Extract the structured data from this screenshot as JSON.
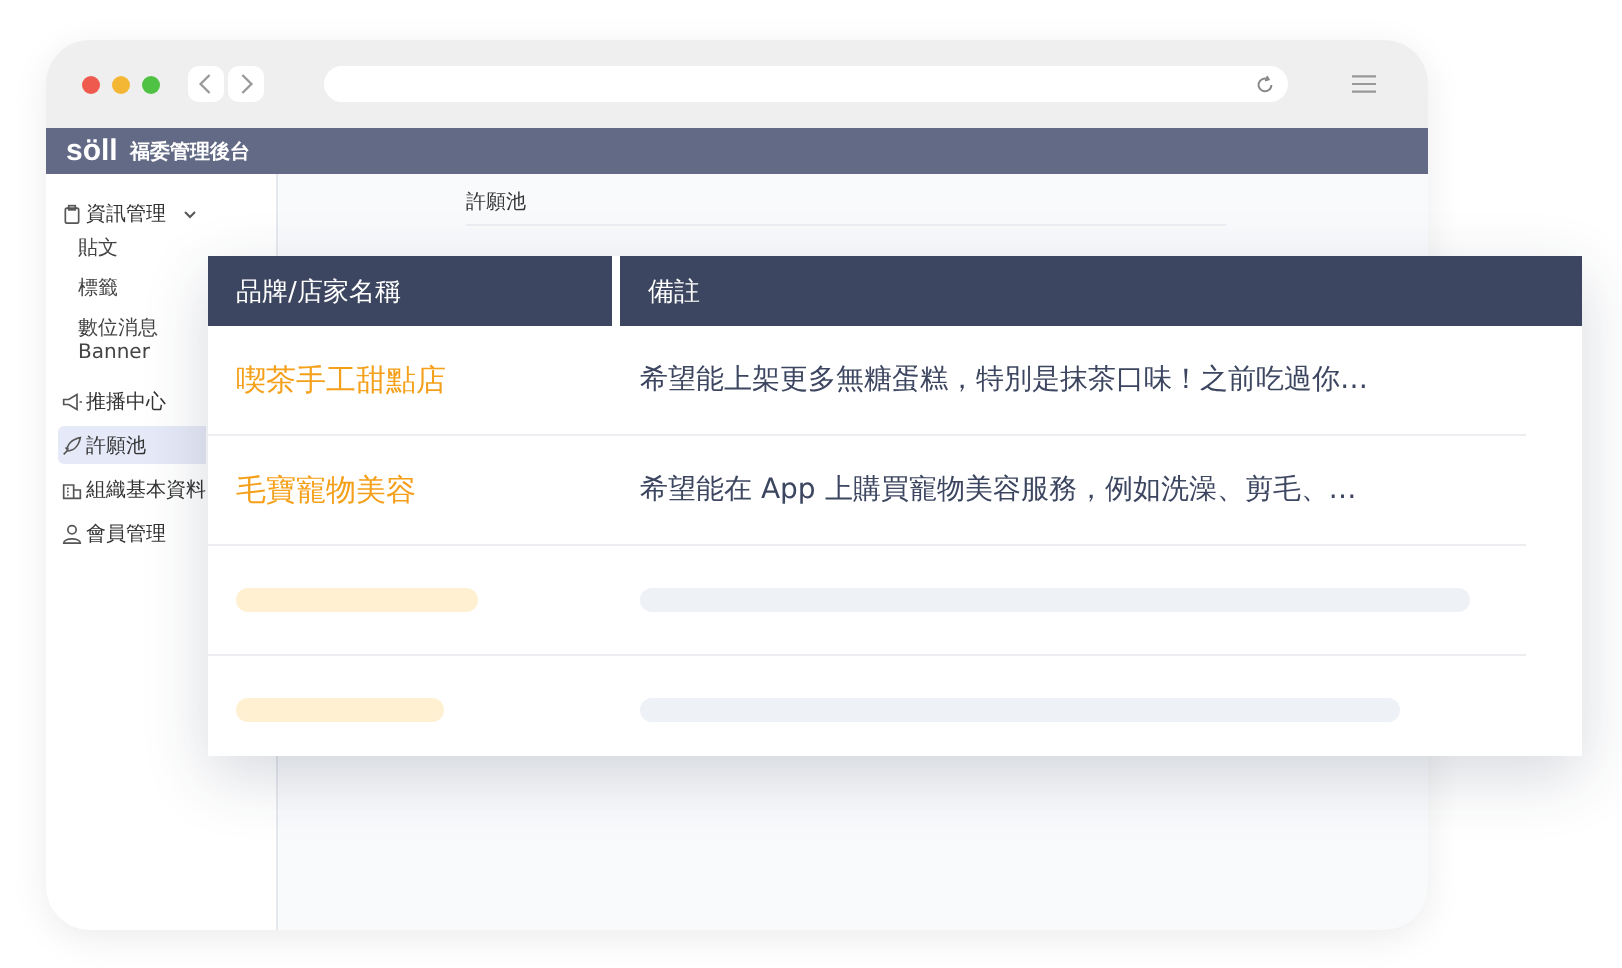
{
  "app": {
    "logo": "söll",
    "subtitle": "福委管理後台"
  },
  "sidebar": {
    "items": [
      {
        "label": "資訊管理",
        "expanded": true,
        "selected": false,
        "children": [
          {
            "label": "貼文",
            "selected": false
          },
          {
            "label": "標籤",
            "selected": false
          },
          {
            "label": "數位消息 Banner",
            "selected": false
          }
        ]
      },
      {
        "label": "推播中心",
        "selected": false
      },
      {
        "label": "許願池",
        "selected": true
      },
      {
        "label": "組織基本資料",
        "selected": false
      },
      {
        "label": "會員管理",
        "selected": false
      }
    ]
  },
  "breadcrumb": "許願池",
  "table": {
    "columns": [
      "品牌/店家名稱",
      "備註"
    ],
    "rows": [
      {
        "kind": "data",
        "name": "喫茶手工甜點店",
        "note": "希望能上架更多無糖蛋糕，特別是抹茶口味！之前吃過你…"
      },
      {
        "kind": "data",
        "name": "毛寶寵物美容",
        "note": "希望能在 App 上購買寵物美容服務，例如洗澡、剪毛、…"
      },
      {
        "kind": "skeleton"
      },
      {
        "kind": "skeleton"
      }
    ]
  }
}
